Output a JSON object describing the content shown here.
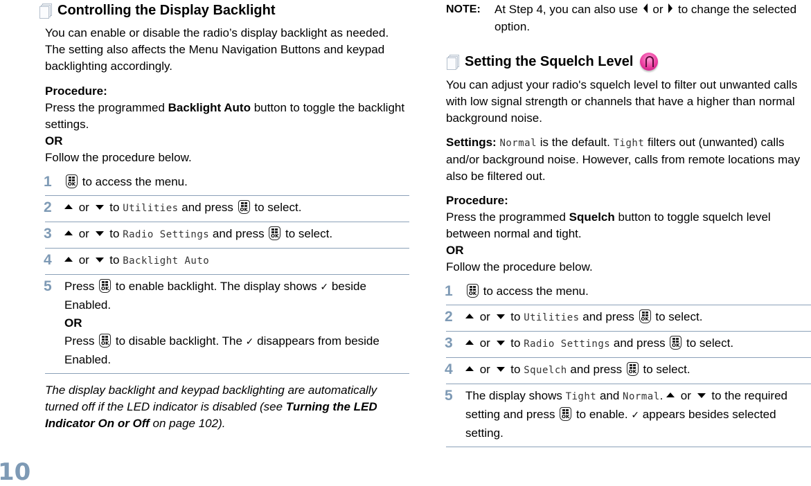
{
  "page_number": "10",
  "left": {
    "heading": "Controlling the Display Backlight",
    "intro": "You can enable or disable the radio’s display backlight as needed. The setting also affects the Menu Navigation Buttons and keypad backlighting accordingly.",
    "procedure_label": "Procedure:",
    "procedure_pre": "Press the programmed ",
    "procedure_bold": "Backlight Auto",
    "procedure_post": " button to toggle the backlight settings.",
    "or_label": "OR",
    "follow": "Follow the procedure below.",
    "steps": [
      {
        "num": "1",
        "text": " to access the menu."
      },
      {
        "num": "2",
        "or": " or ",
        "to": " to ",
        "menu": "Utilities",
        "mid": " and press ",
        "end": " to select."
      },
      {
        "num": "3",
        "or": " or ",
        "to": " to ",
        "menu": "Radio Settings",
        "mid": " and press ",
        "end": " to select."
      },
      {
        "num": "4",
        "or": " or ",
        "to": " to ",
        "menu": "Backlight Auto"
      },
      {
        "num": "5",
        "press": "Press ",
        "a": " to enable backlight. The display shows ",
        "check": "✓",
        "b": " beside Enabled.",
        "or": "OR",
        "c": " to disable backlight. The ",
        "d": " disappears from beside Enabled."
      }
    ],
    "note_pre": "The display backlight and keypad backlighting are automatically turned off if the LED indicator is disabled (see ",
    "note_link": "Turning the LED Indicator On or Off",
    "note_post": " on page 102)."
  },
  "right": {
    "note_label": "NOTE:",
    "note_a": "At Step 4, you can also use ",
    "note_or": " or ",
    "note_b": " to change the selected option.",
    "heading": "Setting the Squelch Level",
    "intro": "You can adjust your radio's squelch level to filter out unwanted calls with low signal strength or channels that have a higher than normal background noise.",
    "settings_label": "Settings: ",
    "settings_normal": "Normal",
    "settings_a": " is the default. ",
    "settings_tight": "Tight",
    "settings_b": " filters out (unwanted) calls and/or background noise. However, calls from remote locations may also be filtered out.",
    "procedure_label": "Procedure:",
    "procedure_pre": "Press the programmed ",
    "procedure_bold": "Squelch",
    "procedure_post": " button to toggle squelch level between normal and tight.",
    "or_label": "OR",
    "follow": "Follow the procedure below.",
    "steps": [
      {
        "num": "1",
        "text": " to access the menu."
      },
      {
        "num": "2",
        "or": " or ",
        "to": " to ",
        "menu": "Utilities",
        "mid": " and press ",
        "end": " to select."
      },
      {
        "num": "3",
        "or": " or ",
        "to": " to ",
        "menu": "Radio Settings",
        "mid": " and press ",
        "end": " to select."
      },
      {
        "num": "4",
        "or": " or ",
        "to": " to ",
        "menu": "Squelch",
        "mid": " and press ",
        "end": " to select."
      },
      {
        "num": "5",
        "a": "The display shows ",
        "tight": "Tight",
        "and": " and ",
        "normal": "Normal",
        "dot": ". ",
        "or": " or ",
        "b": " to the required setting and press ",
        "c": " to enable. ",
        "check": "✓",
        "d": " appears besides selected setting."
      }
    ]
  },
  "icons": {
    "ok_key_label": "OK"
  }
}
